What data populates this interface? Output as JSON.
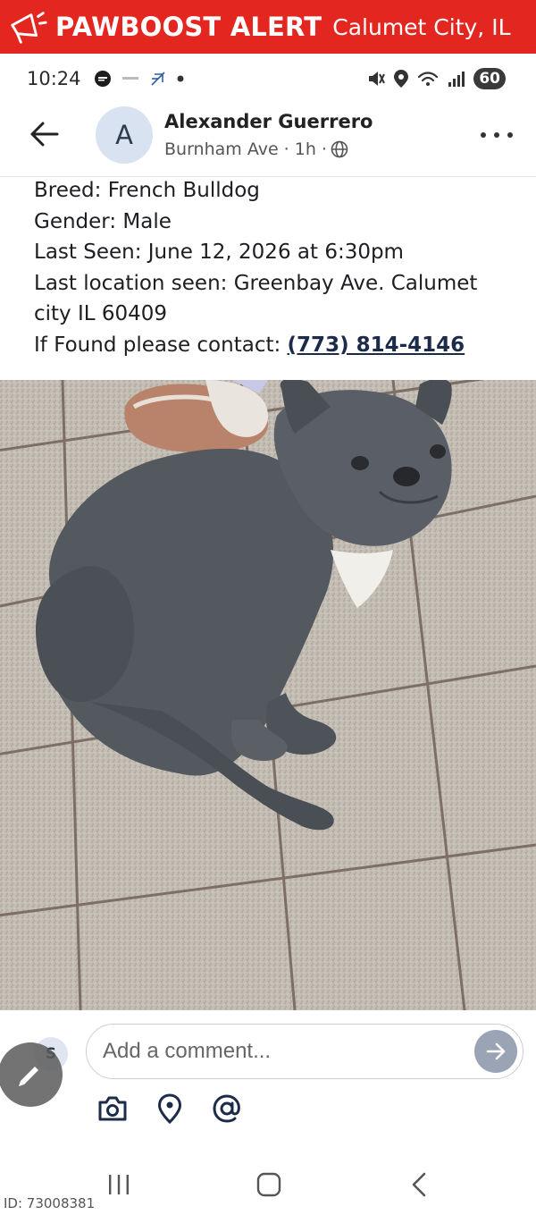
{
  "alert": {
    "brand": "PAWBOOST ALERT",
    "city": "Calumet City, IL",
    "color": "#e3261f"
  },
  "status_bar": {
    "time": "10:24",
    "battery": "60"
  },
  "post": {
    "author_initial": "A",
    "author_name": "Alexander Guerrero",
    "meta": "Burnham Ave · 1h ·",
    "lines": {
      "breed": "Breed: French Bulldog",
      "gender": "Gender: Male",
      "last_seen": "Last Seen: June 12, 2026 at 6:30pm",
      "location_1": "Last location seen: Greenbay Ave. Calumet",
      "location_2": "city IL 60409",
      "contact_label": "If Found please contact: ",
      "contact_phone": "(773) 814-4146"
    }
  },
  "comment": {
    "user_initial": "S",
    "placeholder": "Add a comment..."
  },
  "footer": {
    "id_label": "ID: 73008381"
  }
}
